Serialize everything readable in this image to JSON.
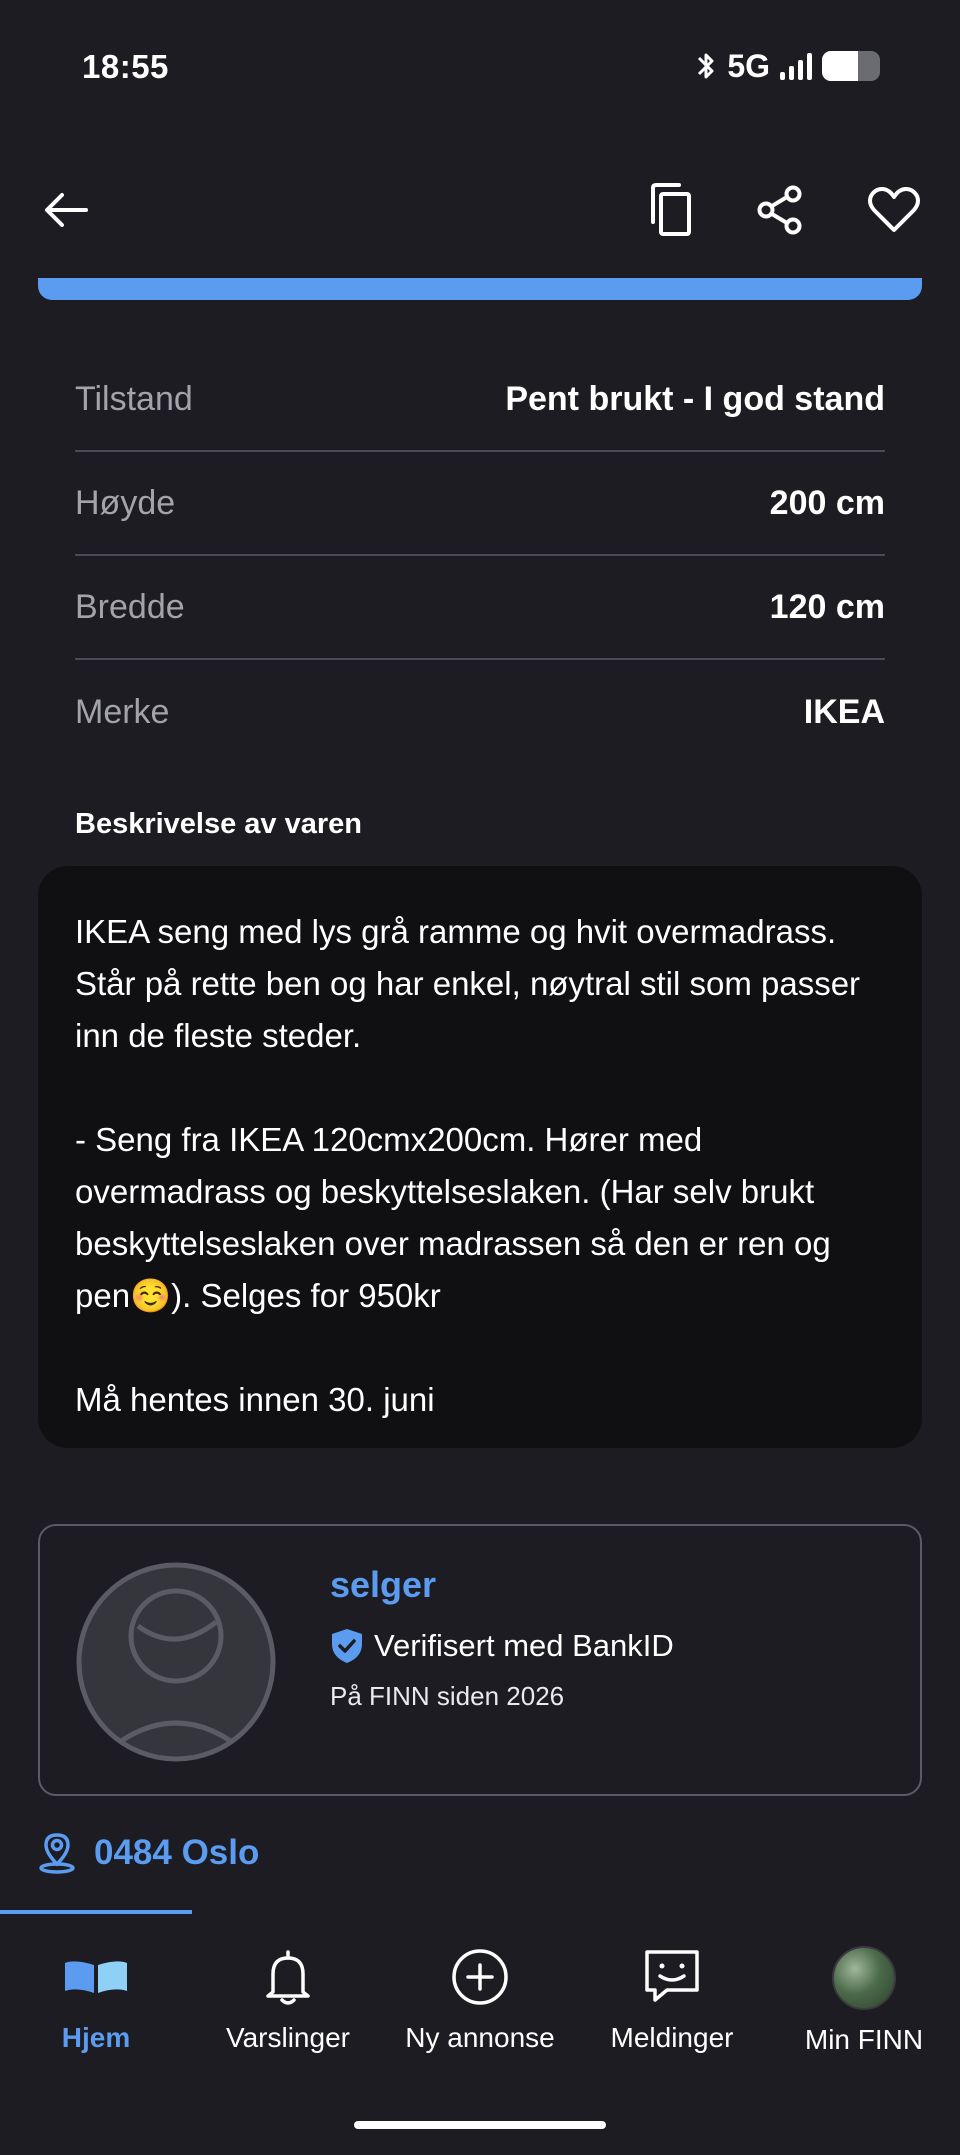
{
  "status_bar": {
    "time": "18:55",
    "network": "5G",
    "battery_level": 0.62,
    "signal_bars": 4
  },
  "top_nav": {
    "back_icon": "arrow-left-icon",
    "copy_icon": "copy-icon",
    "share_icon": "share-icon",
    "favorite_icon": "heart-icon"
  },
  "specs": [
    {
      "label": "Tilstand",
      "value": "Pent brukt - I god stand"
    },
    {
      "label": "Høyde",
      "value": "200 cm"
    },
    {
      "label": "Bredde",
      "value": "120 cm"
    },
    {
      "label": "Merke",
      "value": "IKEA"
    }
  ],
  "description": {
    "heading": "Beskrivelse av varen",
    "paragraphs": [
      "IKEA seng med lys grå ramme og hvit overmadrass. Står på rette ben og har enkel, nøytral stil som passer inn de fleste steder.",
      "",
      "- Seng fra IKEA 120cmx200cm. Hører med overmadrass og beskyttelseslaken. (Har selv brukt beskyttelseslaken over madrassen så den er ren og pen☺️). Selges for 950kr",
      "",
      "Må hentes innen 30. juni"
    ]
  },
  "seller": {
    "name": "selger",
    "verified_text": "Verifisert med BankID",
    "since_text": "På FINN siden 2026"
  },
  "location": {
    "text": "0484 Oslo"
  },
  "bottom_nav": {
    "tabs": [
      {
        "label": "Hjem",
        "icon": "home-book-icon",
        "active": true
      },
      {
        "label": "Varslinger",
        "icon": "bell-icon",
        "active": false
      },
      {
        "label": "Ny annonse",
        "icon": "plus-circle-icon",
        "active": false
      },
      {
        "label": "Meldinger",
        "icon": "chat-icon",
        "active": false
      },
      {
        "label": "Min FINN",
        "icon": "profile-photo-icon",
        "active": false
      }
    ]
  },
  "colors": {
    "background": "#1c1c22",
    "accent": "#5b9cf0",
    "description_bg": "#101012"
  }
}
